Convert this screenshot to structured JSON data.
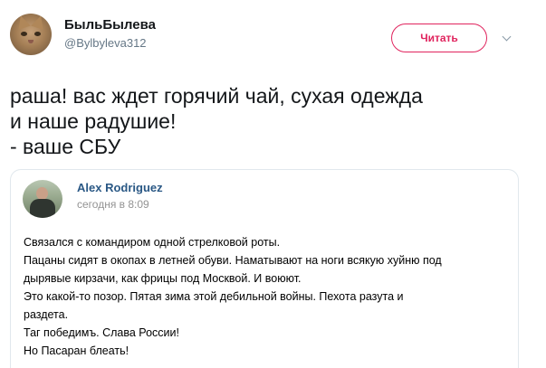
{
  "tweet": {
    "author_name": "БыльБылева",
    "author_handle": "@Bylbyleva312",
    "follow_label": "Читать",
    "text": "раша! вас ждет горячий чай, сухая одежда\nи наше радушие!\n- ваше СБУ"
  },
  "quote": {
    "author_name": "Alex Rodriguez",
    "timestamp": "сегодня в 8:09",
    "lines": [
      "Связался с командиром одной стрелковой роты.",
      "Пацаны сидят в окопах в летней обуви. Наматывают на ноги всякую хуйню под",
      "дырявые кирзачи, как фрицы под Москвой. И воюют.",
      "Это какой-то позор. Пятая зима этой дебильной войны. Пехота разута и",
      "раздета.",
      "Таг победимъ. Слава России!",
      "Но Пасаран блеать!"
    ]
  },
  "colors": {
    "accent": "#e0245e",
    "secondary_text": "#657786",
    "quote_name": "#2a5885",
    "quote_time": "#939393",
    "border": "#e1e8ed"
  },
  "icons": {
    "more": "chevron-down-icon"
  }
}
